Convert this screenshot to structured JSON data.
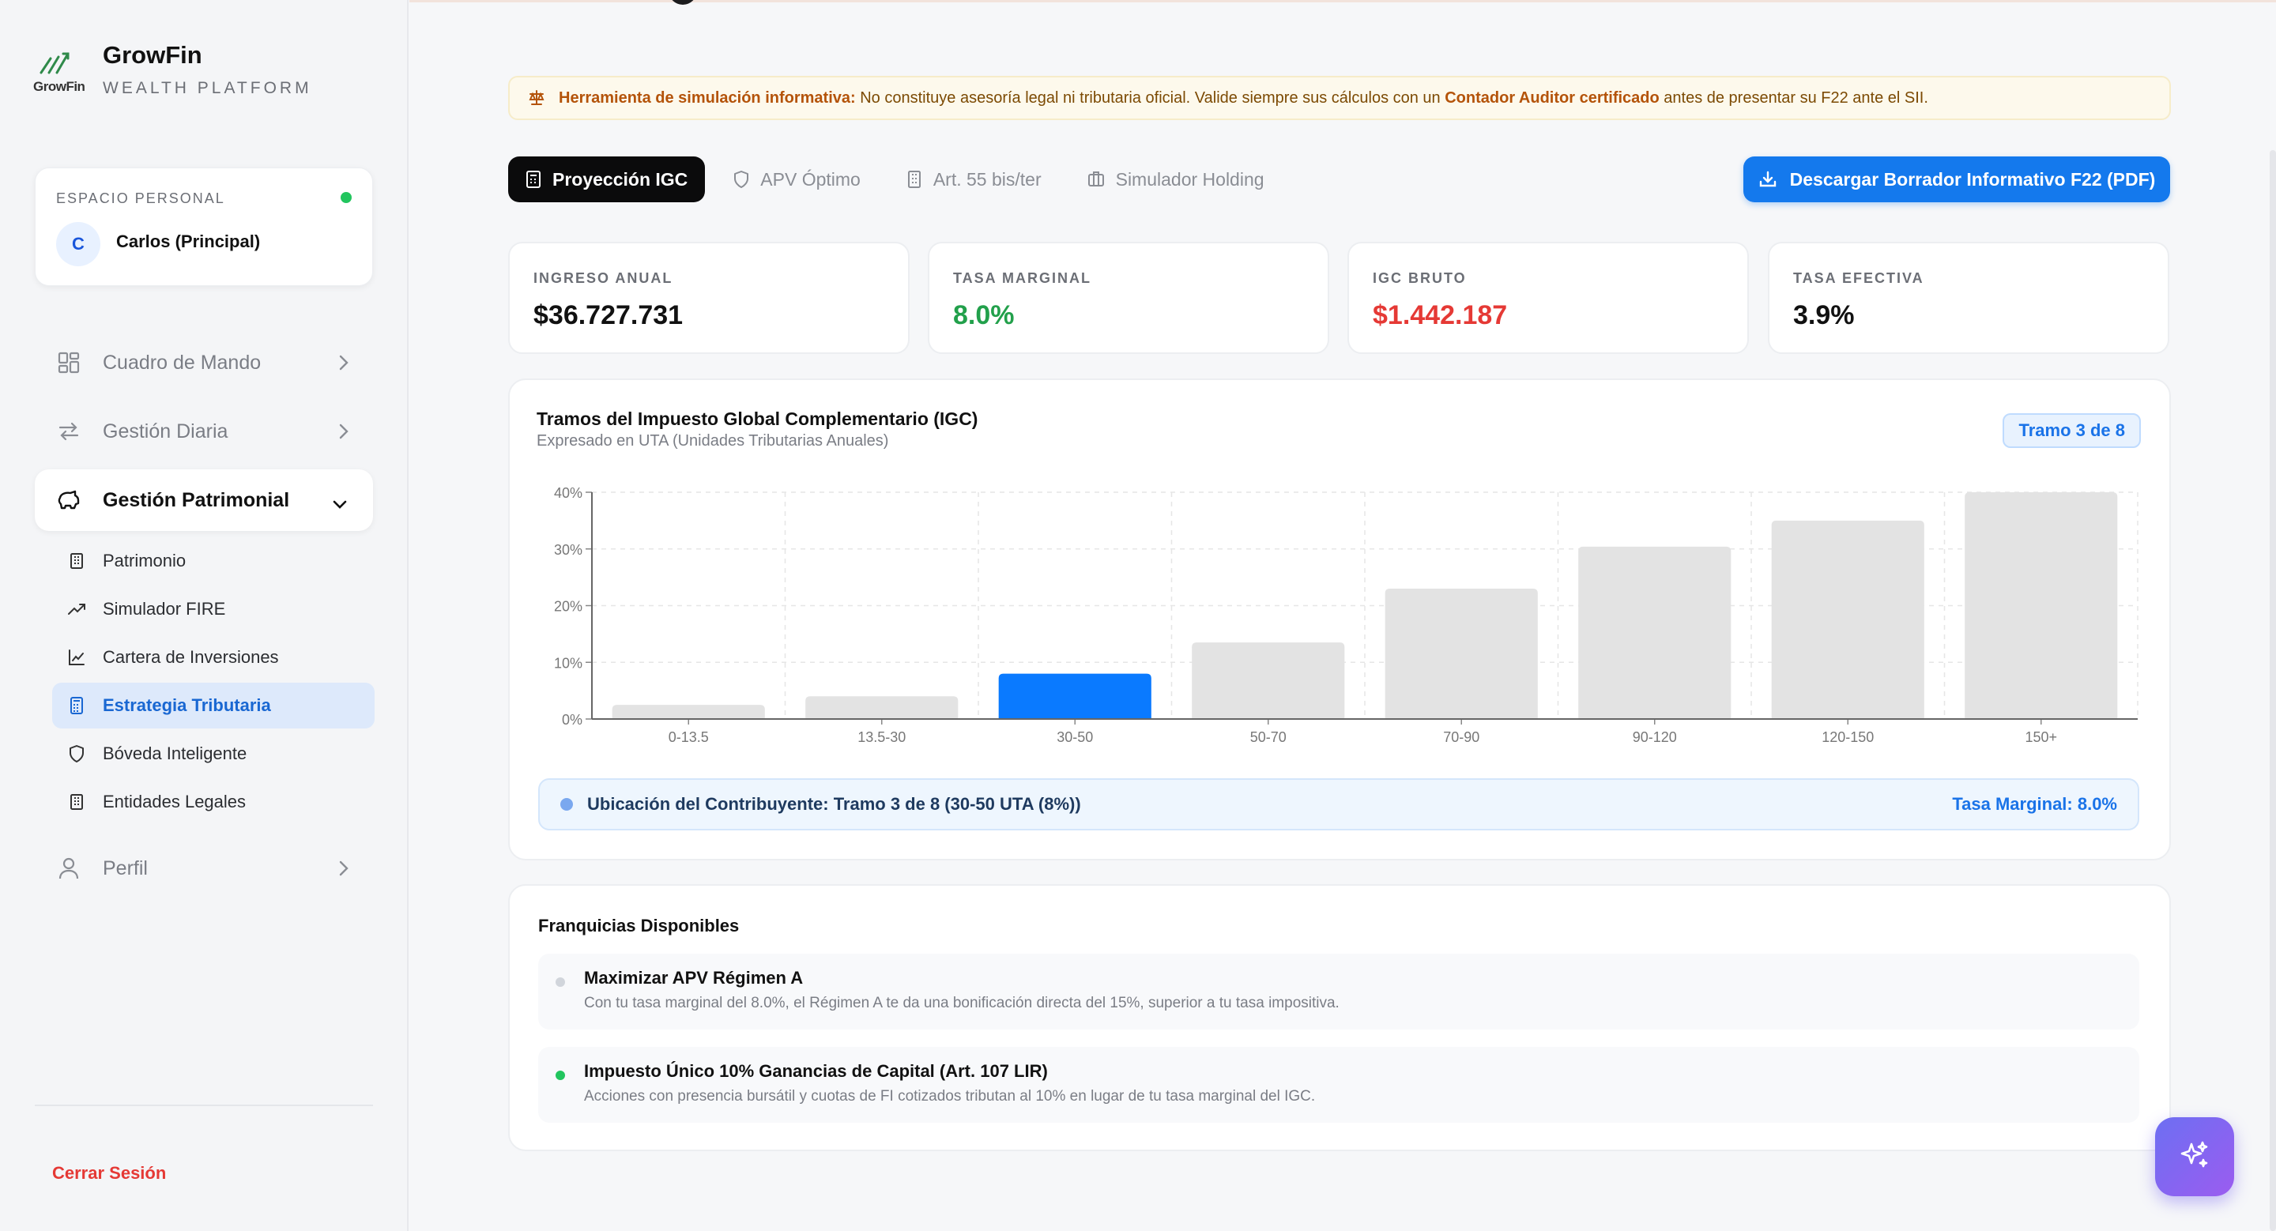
{
  "brand": {
    "name": "GrowFin",
    "subtitle": "WEALTH PLATFORM",
    "logo_word": "GrowFin"
  },
  "workspace": {
    "label": "ESPACIO PERSONAL",
    "avatar": "C",
    "user": "Carlos (Principal)",
    "status_color": "#22c55e"
  },
  "nav": {
    "cuadro": "Cuadro de Mando",
    "gestion_diaria": "Gestión Diaria",
    "gestion_patrimonial": "Gestión Patrimonial",
    "sub": [
      "Patrimonio",
      "Simulador FIRE",
      "Cartera de Inversiones",
      "Estrategia Tributaria",
      "Bóveda Inteligente",
      "Entidades Legales"
    ],
    "perfil": "Perfil",
    "logout": "Cerrar Sesión"
  },
  "disclaimer": {
    "bold1": "Herramienta de simulación informativa:",
    "text1": " No constituye asesoría legal ni tributaria oficial. Valide siempre sus cálculos con un ",
    "bold2": "Contador Auditor certificado",
    "text2": " antes de presentar su F22 ante el SII."
  },
  "tabs": [
    "Proyección IGC",
    "APV Óptimo",
    "Art. 55 bis/ter",
    "Simulador Holding"
  ],
  "download_label": "Descargar Borrador Informativo F22 (PDF)",
  "kpis": [
    {
      "label": "INGRESO ANUAL",
      "value": "$36.727.731",
      "color": "#111111"
    },
    {
      "label": "TASA MARGINAL",
      "value": "8.0%",
      "color": "#22a04b"
    },
    {
      "label": "IGC BRUTO",
      "value": "$1.442.187",
      "color": "#e53935"
    },
    {
      "label": "TASA EFECTIVA",
      "value": "3.9%",
      "color": "#111111"
    }
  ],
  "chart_card": {
    "title": "Tramos del Impuesto Global Complementario (IGC)",
    "subtitle": "Expresado en UTA (Unidades Tributarias Anuales)",
    "badge": "Tramo 3 de 8"
  },
  "chart_data": {
    "type": "bar",
    "categories": [
      "0-13.5",
      "13.5-30",
      "30-50",
      "50-70",
      "70-90",
      "90-120",
      "120-150",
      "150+"
    ],
    "values": [
      2.5,
      4,
      8,
      13.5,
      23,
      30.4,
      35,
      40
    ],
    "highlight_index": 2,
    "highlight_color": "#0a7aff",
    "bar_color": "#e3e3e3",
    "ylim": [
      0,
      40
    ],
    "yticks": [
      "0%",
      "10%",
      "20%",
      "30%",
      "40%"
    ],
    "ytick_values": [
      0,
      10,
      20,
      30,
      40
    ],
    "grid": true
  },
  "ubicacion": {
    "text": "Ubicación del Contribuyente: Tramo 3 de 8 (30-50 UTA (8%))",
    "right": "Tasa Marginal: 8.0%"
  },
  "franquicias": {
    "title": "Franquicias Disponibles",
    "items": [
      {
        "name": "Maximizar APV Régimen A",
        "desc": "Con tu tasa marginal del 8.0%, el Régimen A te da una bonificación directa del 15%, superior a tu tasa impositiva.",
        "dot": "#d1d5db"
      },
      {
        "name": "Impuesto Único 10% Ganancias de Capital (Art. 107 LIR)",
        "desc": "Acciones con presencia bursátil y cuotas de FI cotizados tributan al 10% en lugar de tu tasa marginal del IGC.",
        "dot": "#22c55e"
      }
    ]
  }
}
